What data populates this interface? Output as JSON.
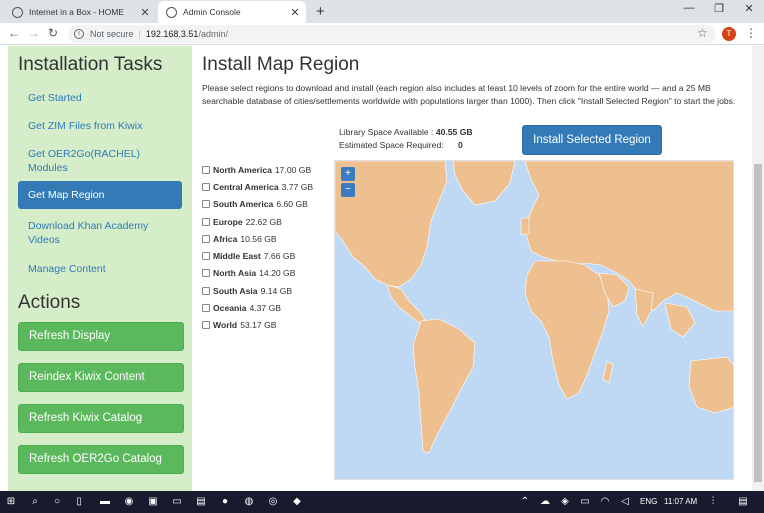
{
  "browser": {
    "tabs": [
      {
        "title": "Internet in a Box - HOME"
      },
      {
        "title": "Admin Console"
      }
    ],
    "url_security": "Not secure",
    "url_host": "192.168.3.51",
    "url_path": "/admin/",
    "avatar_letter": "T"
  },
  "sidebar": {
    "tasks_heading": "Installation Tasks",
    "tasks": [
      {
        "label": "Get Started"
      },
      {
        "label": "Get ZIM Files from Kiwix"
      },
      {
        "label": "Get OER2Go(RACHEL) Modules"
      },
      {
        "label": "Get Map Region"
      },
      {
        "label": "Download Khan Academy Videos"
      },
      {
        "label": "Manage Content"
      }
    ],
    "actions_heading": "Actions",
    "actions": [
      {
        "label": "Refresh Display"
      },
      {
        "label": "Reindex Kiwix Content"
      },
      {
        "label": "Refresh Kiwix Catalog"
      },
      {
        "label": "Refresh OER2Go Catalog"
      }
    ]
  },
  "main": {
    "title": "Install Map Region",
    "description": "Please select regions to download and install (each region also includes at least 10 levels of zoom for the entire world — and a 25 MB searchable database of cities/settlements worldwide with populations larger than 1000). Then click \"Install Selected Region\" to start the jobs.",
    "library_space_label": "Library Space Available :",
    "library_space_value": "40.55 GB",
    "estimated_label": "Estimated Space Required:",
    "estimated_value": "0",
    "install_button": "Install Selected Region",
    "regions": [
      {
        "name": "North America",
        "size": "17.00 GB"
      },
      {
        "name": "Central America",
        "size": "3.77 GB"
      },
      {
        "name": "South America",
        "size": "6.60 GB"
      },
      {
        "name": "Europe",
        "size": "22.62 GB"
      },
      {
        "name": "Africa",
        "size": "10.56 GB"
      },
      {
        "name": "Middle East",
        "size": "7.66 GB"
      },
      {
        "name": "North Asia",
        "size": "14.20 GB"
      },
      {
        "name": "South Asia",
        "size": "9.14 GB"
      },
      {
        "name": "Oceania",
        "size": "4.37 GB"
      },
      {
        "name": "World",
        "size": "53.17 GB"
      }
    ],
    "zoom_in": "+",
    "zoom_out": "−"
  },
  "taskbar": {
    "language": "ENG",
    "time": "11:07 AM"
  },
  "colors": {
    "sidebar_bg": "#d6edc9",
    "active_blue": "#337ab7",
    "action_green": "#5cb85c",
    "land": "#efc08f",
    "water": "#bfd9f5"
  }
}
